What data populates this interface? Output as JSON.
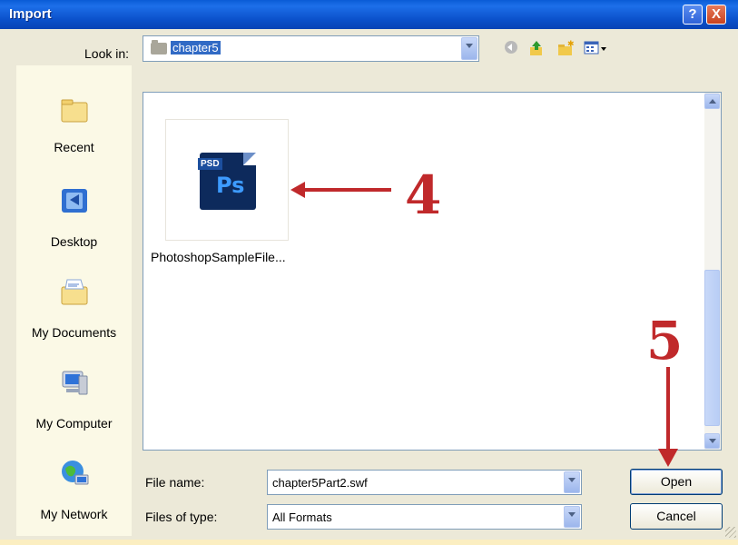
{
  "dialog": {
    "title": "Import",
    "help_symbol": "?",
    "close_symbol": "X",
    "colors": {
      "titlebar": "#0a5bd6",
      "annotation": "#c0292b",
      "places_bg": "#fbf9e6"
    }
  },
  "look_in": {
    "label": "Look in:",
    "value": "chapter5"
  },
  "toolbar": {
    "icons": [
      "back-icon",
      "up-folder-icon",
      "new-folder-icon",
      "view-menu-icon"
    ]
  },
  "places": [
    {
      "label": "Recent",
      "icon": "recent-folder-icon"
    },
    {
      "label": "Desktop",
      "icon": "desktop-icon"
    },
    {
      "label": "My Documents",
      "icon": "my-documents-icon"
    },
    {
      "label": "My Computer",
      "icon": "my-computer-icon"
    },
    {
      "label": "My Network",
      "icon": "my-network-icon"
    }
  ],
  "files": [
    {
      "name": "PhotoshopSampleFile...",
      "tag": "PSD",
      "badge": "Ps"
    }
  ],
  "annotations": {
    "step4": "4",
    "step5": "5"
  },
  "file_name": {
    "label": "File name:",
    "value": "chapter5Part2.swf"
  },
  "file_type": {
    "label": "Files of type:",
    "value": "All Formats"
  },
  "buttons": {
    "open": "Open",
    "cancel": "Cancel"
  }
}
